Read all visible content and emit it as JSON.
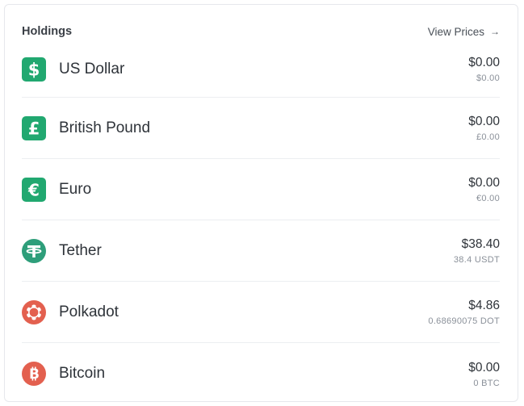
{
  "header": {
    "title": "Holdings",
    "view_prices_label": "View Prices",
    "arrow": "→"
  },
  "colors": {
    "fiat_green": "#21a870",
    "tether_green": "#2e9e7a",
    "polkadot_red": "#e3604f",
    "bitcoin_red": "#e3604f"
  },
  "holdings": [
    {
      "name": "US Dollar",
      "primary": "$0.00",
      "secondary": "$0.00",
      "icon": "dollar-icon"
    },
    {
      "name": "British Pound",
      "primary": "$0.00",
      "secondary": "£0.00",
      "icon": "pound-icon"
    },
    {
      "name": "Euro",
      "primary": "$0.00",
      "secondary": "€0.00",
      "icon": "euro-icon"
    },
    {
      "name": "Tether",
      "primary": "$38.40",
      "secondary": "38.4 USDT",
      "icon": "tether-icon"
    },
    {
      "name": "Polkadot",
      "primary": "$4.86",
      "secondary": "0.68690075 DOT",
      "icon": "polkadot-icon"
    },
    {
      "name": "Bitcoin",
      "primary": "$0.00",
      "secondary": "0 BTC",
      "icon": "bitcoin-icon"
    }
  ]
}
